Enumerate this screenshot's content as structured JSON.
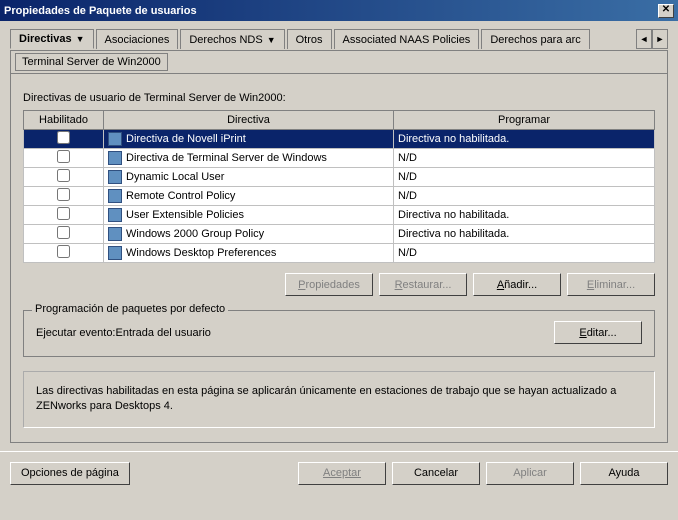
{
  "title": "Propiedades de Paquete de usuarios",
  "tabs": {
    "active": "Directivas",
    "list": [
      "Asociaciones",
      "Derechos NDS",
      "Otros",
      "Associated NAAS Policies",
      "Derechos para arc"
    ]
  },
  "subtab": "Terminal Server de Win2000",
  "section_label": "Directivas de usuario de Terminal Server de Win2000:",
  "table": {
    "headers": {
      "enabled": "Habilitado",
      "policy": "Directiva",
      "schedule": "Programar"
    },
    "rows": [
      {
        "enabled": false,
        "policy": "Directiva de Novell iPrint",
        "schedule": "Directiva no habilitada.",
        "selected": true
      },
      {
        "enabled": false,
        "policy": "Directiva de Terminal Server de Windows",
        "schedule": "N/D",
        "selected": false
      },
      {
        "enabled": false,
        "policy": "Dynamic Local User",
        "schedule": "N/D",
        "selected": false
      },
      {
        "enabled": false,
        "policy": "Remote Control Policy",
        "schedule": "N/D",
        "selected": false
      },
      {
        "enabled": false,
        "policy": "User Extensible Policies",
        "schedule": "Directiva no habilitada.",
        "selected": false
      },
      {
        "enabled": false,
        "policy": "Windows 2000 Group Policy",
        "schedule": "Directiva no habilitada.",
        "selected": false
      },
      {
        "enabled": false,
        "policy": "Windows Desktop Preferences",
        "schedule": "N/D",
        "selected": false
      }
    ]
  },
  "buttons": {
    "props": "Propiedades",
    "restore": "Restaurar...",
    "add": "Añadir...",
    "delete": "Eliminar..."
  },
  "group": {
    "title": "Programación de paquetes por defecto",
    "event_label": "Ejecutar evento:Entrada del usuario",
    "edit": "Editar..."
  },
  "info": "Las directivas habilitadas en esta página se aplicarán únicamente en estaciones de trabajo que se hayan actualizado a ZENworks para Desktops 4.",
  "bottom": {
    "page_options": "Opciones de página",
    "ok": "Aceptar",
    "cancel": "Cancelar",
    "apply": "Aplicar",
    "help": "Ayuda"
  }
}
